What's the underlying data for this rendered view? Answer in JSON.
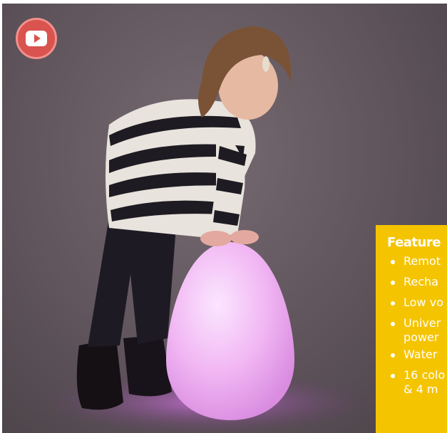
{
  "video_button": {
    "icon": "youtube-play-icon",
    "accent": "#d9534f"
  },
  "features": {
    "heading": "Feature",
    "items": [
      {
        "text": "Remot"
      },
      {
        "text": "Recha"
      },
      {
        "text": "Low vo"
      },
      {
        "text": "Univer",
        "text2": "power"
      },
      {
        "text": "Water"
      },
      {
        "text": "16 colo",
        "text2": "& 4 m"
      }
    ],
    "background": "#f5c400",
    "text_color": "#ffffff"
  }
}
